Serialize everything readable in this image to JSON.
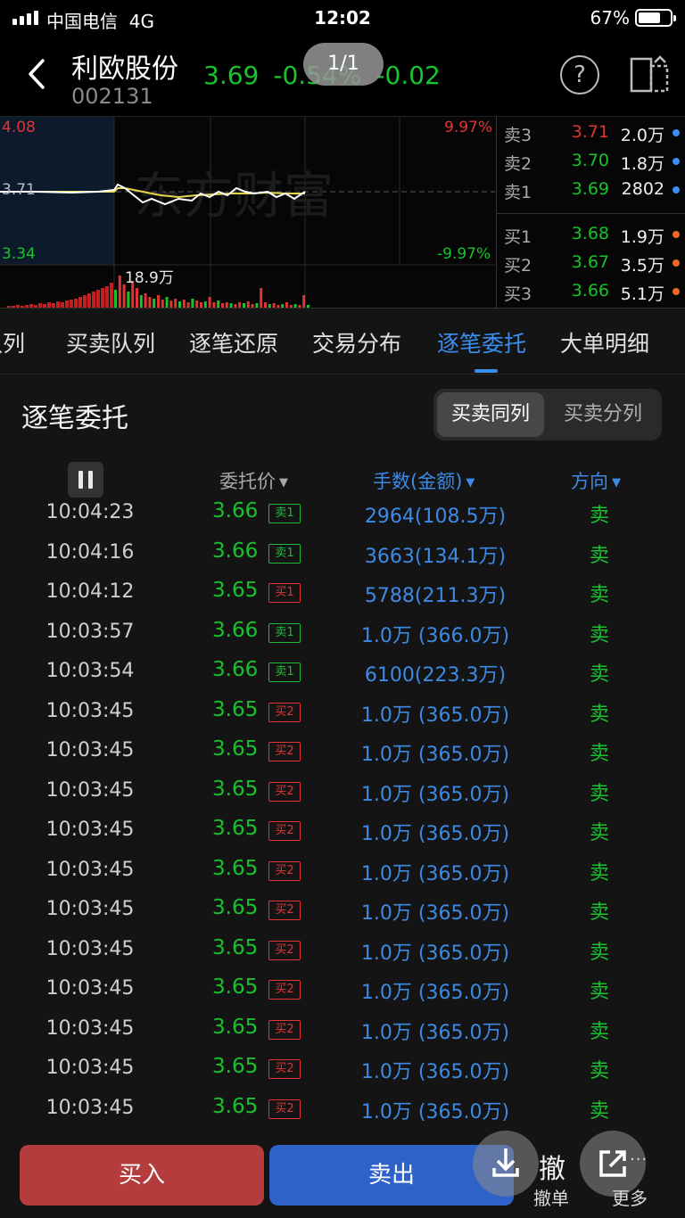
{
  "status_bar": {
    "carrier": "中国电信",
    "network": "4G",
    "time": "12:02",
    "battery": "67%",
    "battery_level": 0.67
  },
  "header": {
    "stock_name": "利欧股份",
    "stock_code": "002131",
    "price": "3.69",
    "change_pct": "-0.54%",
    "change": "-0.02",
    "page_indicator": "1/1",
    "help_icon": "question-circle-icon",
    "window_icon": "split-window-icon"
  },
  "chart": {
    "high_price": "4.08",
    "mid_price": "3.71",
    "low_price": "3.34",
    "high_pct": "9.97%",
    "low_pct": "-9.97%",
    "volume_label": "18.9万",
    "watermark": "东方财富",
    "colors": {
      "up": "#e23434",
      "down": "#18c22d",
      "price_line": "#ffffff",
      "avg_line": "#e6d64a"
    }
  },
  "order_book": {
    "asks": [
      {
        "label": "卖3",
        "price": "3.71",
        "volume": "2.0万"
      },
      {
        "label": "卖2",
        "price": "3.70",
        "volume": "1.8万"
      },
      {
        "label": "卖1",
        "price": "3.69",
        "volume": "2802"
      }
    ],
    "bids": [
      {
        "label": "买1",
        "price": "3.68",
        "volume": "1.9万"
      },
      {
        "label": "买2",
        "price": "3.67",
        "volume": "3.5万"
      },
      {
        "label": "买3",
        "price": "3.66",
        "volume": "5.1万"
      }
    ]
  },
  "tabs": [
    {
      "label": "队列"
    },
    {
      "label": "买卖队列"
    },
    {
      "label": "逐笔还原"
    },
    {
      "label": "交易分布"
    },
    {
      "label": "逐笔委托",
      "active": true
    },
    {
      "label": "大单明细"
    }
  ],
  "panel": {
    "title": "逐笔委托",
    "segment_on": "买卖同列",
    "segment_off": "买卖分列",
    "pause_icon": "pause-icon",
    "col_price": "委托价",
    "col_amount": "手数(金额)",
    "col_direction": "方向"
  },
  "rows": [
    {
      "time": "10:04:23",
      "price": "3.66",
      "badge": "卖1",
      "badge_type": "sell",
      "amount": "2964(108.5万)",
      "dir": "卖"
    },
    {
      "time": "10:04:16",
      "price": "3.66",
      "badge": "卖1",
      "badge_type": "sell",
      "amount": "3663(134.1万)",
      "dir": "卖"
    },
    {
      "time": "10:04:12",
      "price": "3.65",
      "badge": "买1",
      "badge_type": "buy",
      "amount": "5788(211.3万)",
      "dir": "卖"
    },
    {
      "time": "10:03:57",
      "price": "3.66",
      "badge": "卖1",
      "badge_type": "sell",
      "amount": "1.0万 (366.0万)",
      "dir": "卖"
    },
    {
      "time": "10:03:54",
      "price": "3.66",
      "badge": "卖1",
      "badge_type": "sell",
      "amount": "6100(223.3万)",
      "dir": "卖"
    },
    {
      "time": "10:03:45",
      "price": "3.65",
      "badge": "买2",
      "badge_type": "buy",
      "amount": "1.0万 (365.0万)",
      "dir": "卖"
    },
    {
      "time": "10:03:45",
      "price": "3.65",
      "badge": "买2",
      "badge_type": "buy",
      "amount": "1.0万 (365.0万)",
      "dir": "卖"
    },
    {
      "time": "10:03:45",
      "price": "3.65",
      "badge": "买2",
      "badge_type": "buy",
      "amount": "1.0万 (365.0万)",
      "dir": "卖"
    },
    {
      "time": "10:03:45",
      "price": "3.65",
      "badge": "买2",
      "badge_type": "buy",
      "amount": "1.0万 (365.0万)",
      "dir": "卖"
    },
    {
      "time": "10:03:45",
      "price": "3.65",
      "badge": "买2",
      "badge_type": "buy",
      "amount": "1.0万 (365.0万)",
      "dir": "卖"
    },
    {
      "time": "10:03:45",
      "price": "3.65",
      "badge": "买2",
      "badge_type": "buy",
      "amount": "1.0万 (365.0万)",
      "dir": "卖"
    },
    {
      "time": "10:03:45",
      "price": "3.65",
      "badge": "买2",
      "badge_type": "buy",
      "amount": "1.0万 (365.0万)",
      "dir": "卖"
    },
    {
      "time": "10:03:45",
      "price": "3.65",
      "badge": "买2",
      "badge_type": "buy",
      "amount": "1.0万 (365.0万)",
      "dir": "卖"
    },
    {
      "time": "10:03:45",
      "price": "3.65",
      "badge": "买2",
      "badge_type": "buy",
      "amount": "1.0万 (365.0万)",
      "dir": "卖"
    },
    {
      "time": "10:03:45",
      "price": "3.65",
      "badge": "买2",
      "badge_type": "buy",
      "amount": "1.0万 (365.0万)",
      "dir": "卖"
    },
    {
      "time": "10:03:45",
      "price": "3.65",
      "badge": "买2",
      "badge_type": "buy",
      "amount": "1.0万 (365.0万)",
      "dir": "卖"
    }
  ],
  "bottom": {
    "buy": "买入",
    "sell": "卖出",
    "cancel_big": "撤",
    "cancel": "撤单",
    "more": "更多",
    "more_dots": "···",
    "download_icon": "download-icon",
    "share_icon": "share-icon"
  }
}
